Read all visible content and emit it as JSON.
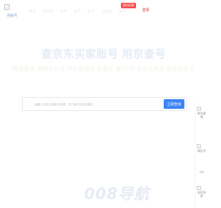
{
  "header": {
    "logo_text": "闲鱼号",
    "nav_items": [
      "首页",
      "资讯号",
      "买号",
      "卖号",
      "租号",
      "交易号",
      "保号"
    ],
    "badge": "限时优惠",
    "nav_right": "登录"
  },
  "hero": {
    "title": "查京东买家账号 用京查号",
    "subtitle": "降权查询 透明评价号 评价查询号 优惠号 查PC号 京豆派单号 查询京东号"
  },
  "search": {
    "placeholder": "请输入京东买家账号/昵称，多个账号用逗号隔开",
    "button_label": "立即查询"
  },
  "float_bar": {
    "items": [
      "联系客服",
      "微信号",
      "QQ",
      "返回顶部"
    ]
  },
  "watermark": {
    "text": "008导航"
  }
}
